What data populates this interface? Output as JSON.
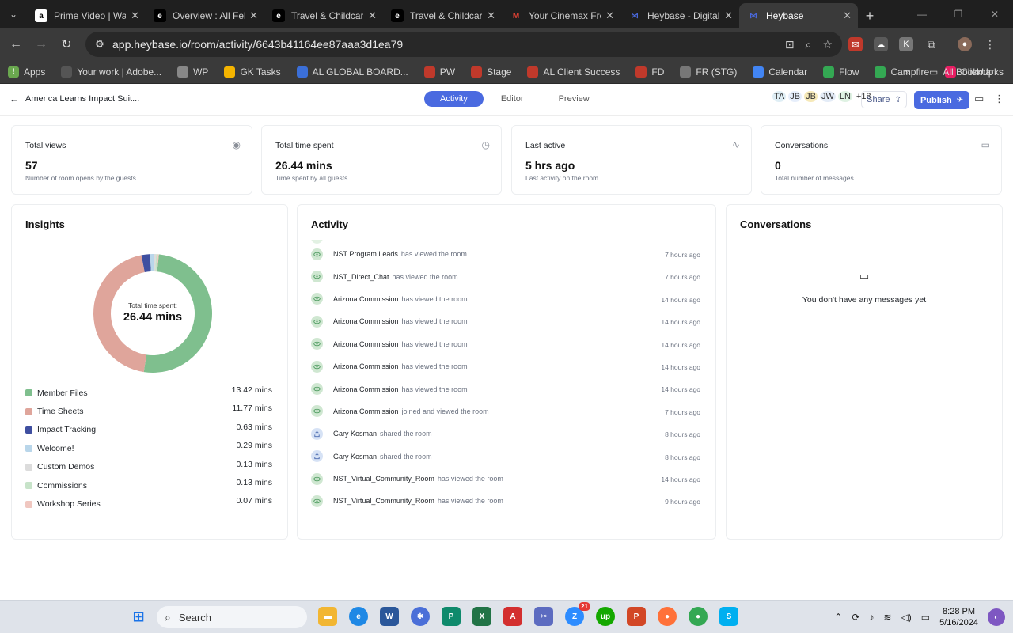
{
  "browser": {
    "tabs": [
      {
        "title": "Prime Video | Wat",
        "icon": "amazon-icon",
        "color": "#ffffff"
      },
      {
        "title": "Overview : All Fell",
        "icon": "e-icon",
        "color": "#000000"
      },
      {
        "title": "Travel & Childcare",
        "icon": "e-icon",
        "color": "#000000"
      },
      {
        "title": "Travel & Childcare",
        "icon": "e-icon",
        "color": "#000000"
      },
      {
        "title": "Your Cinemax Free",
        "icon": "gmail-icon",
        "color": "#ea4335"
      },
      {
        "title": "Heybase - Digital S",
        "icon": "heybase-icon",
        "color": "#4a6ae0"
      },
      {
        "title": "Heybase",
        "icon": "heybase-icon",
        "color": "#4a6ae0"
      }
    ],
    "url": "app.heybase.io/room/activity/6643b41164ee87aaa3d1ea79",
    "bookmarks": [
      {
        "label": "Apps",
        "color": "#6aa84f"
      },
      {
        "label": "Your work | Adobe...",
        "color": "#555555"
      },
      {
        "label": "WP",
        "color": "#888888"
      },
      {
        "label": "GK Tasks",
        "color": "#f4b400"
      },
      {
        "label": "AL GLOBAL BOARD...",
        "color": "#3b6fd8"
      },
      {
        "label": "PW",
        "color": "#c0392b"
      },
      {
        "label": "Stage",
        "color": "#c0392b"
      },
      {
        "label": "AL Client Success",
        "color": "#c0392b"
      },
      {
        "label": "FD",
        "color": "#c0392b"
      },
      {
        "label": "FR (STG)",
        "color": "#777777"
      },
      {
        "label": "Calendar",
        "color": "#4285f4"
      },
      {
        "label": "Flow",
        "color": "#34a853"
      },
      {
        "label": "Campfire",
        "color": "#34a853"
      },
      {
        "label": "ClickUp",
        "color": "#e91e63"
      }
    ],
    "all_bookmarks": "All Bookmarks"
  },
  "header": {
    "back_label": "America Learns Impact Suit...",
    "tabs": [
      "Activity",
      "Editor",
      "Preview"
    ],
    "avatars": [
      "TA",
      "JB",
      "JB",
      "JW",
      "LN",
      "+18"
    ],
    "share_label": "Share",
    "publish_label": "Publish"
  },
  "stats": [
    {
      "label": "Total views",
      "value": "57",
      "sub": "Number of room opens by the guests",
      "icon": "eye-icon"
    },
    {
      "label": "Total time spent",
      "value": "26.44 mins",
      "sub": "Time spent by all guests",
      "icon": "clock-icon"
    },
    {
      "label": "Last active",
      "value": "5 hrs ago",
      "sub": "Last activity on the room",
      "icon": "pulse-icon"
    },
    {
      "label": "Conversations",
      "value": "0",
      "sub": "Total number of messages",
      "icon": "chat-icon"
    }
  ],
  "insights": {
    "title": "Insights",
    "donut_label": "Total time spent:",
    "donut_value": "26.44 mins",
    "items": [
      {
        "name": "Member Files",
        "mins": "13.42 mins",
        "value": 13.42,
        "color": "#7fbf8e"
      },
      {
        "name": "Time Sheets",
        "mins": "11.77 mins",
        "value": 11.77,
        "color": "#dfa59b"
      },
      {
        "name": "Impact Tracking",
        "mins": "0.63 mins",
        "value": 0.63,
        "color": "#3f4fa0"
      },
      {
        "name": "Welcome!",
        "mins": "0.29 mins",
        "value": 0.29,
        "color": "#b9d6ea"
      },
      {
        "name": "Custom Demos",
        "mins": "0.13 mins",
        "value": 0.13,
        "color": "#dcdcdc"
      },
      {
        "name": "Commissions",
        "mins": "0.13 mins",
        "value": 0.13,
        "color": "#c7e3c9"
      },
      {
        "name": "Workshop Series",
        "mins": "0.07 mins",
        "value": 0.07,
        "color": "#f0c7c0"
      }
    ]
  },
  "activity": {
    "title": "Activity",
    "items": [
      {
        "who": "NST Program Leads",
        "what": "has viewed the room",
        "when": "7 hours ago",
        "kind": "view"
      },
      {
        "who": "NST_Direct_Chat",
        "what": "has viewed the room",
        "when": "7 hours ago",
        "kind": "view"
      },
      {
        "who": "Arizona Commission",
        "what": "has viewed the room",
        "when": "14 hours ago",
        "kind": "view"
      },
      {
        "who": "Arizona Commission",
        "what": "has viewed the room",
        "when": "14 hours ago",
        "kind": "view"
      },
      {
        "who": "Arizona Commission",
        "what": "has viewed the room",
        "when": "14 hours ago",
        "kind": "view"
      },
      {
        "who": "Arizona Commission",
        "what": "has viewed the room",
        "when": "14 hours ago",
        "kind": "view"
      },
      {
        "who": "Arizona Commission",
        "what": "has viewed the room",
        "when": "14 hours ago",
        "kind": "view"
      },
      {
        "who": "Arizona Commission",
        "what": "joined and viewed the room",
        "when": "7 hours ago",
        "kind": "view"
      },
      {
        "who": "Gary Kosman",
        "what": "shared the room",
        "when": "8 hours ago",
        "kind": "share"
      },
      {
        "who": "Gary Kosman",
        "what": "shared the room",
        "when": "8 hours ago",
        "kind": "share"
      },
      {
        "who": "NST_Virtual_Community_Room",
        "what": "has viewed the room",
        "when": "14 hours ago",
        "kind": "view"
      },
      {
        "who": "NST_Virtual_Community_Room",
        "what": "has viewed the room",
        "when": "9 hours ago",
        "kind": "view"
      }
    ]
  },
  "conversations": {
    "title": "Conversations",
    "empty_text": "You don't have any messages yet"
  },
  "taskbar": {
    "search_label": "Search",
    "zoom_badge": "21",
    "time": "8:28 PM",
    "date": "5/16/2024"
  }
}
